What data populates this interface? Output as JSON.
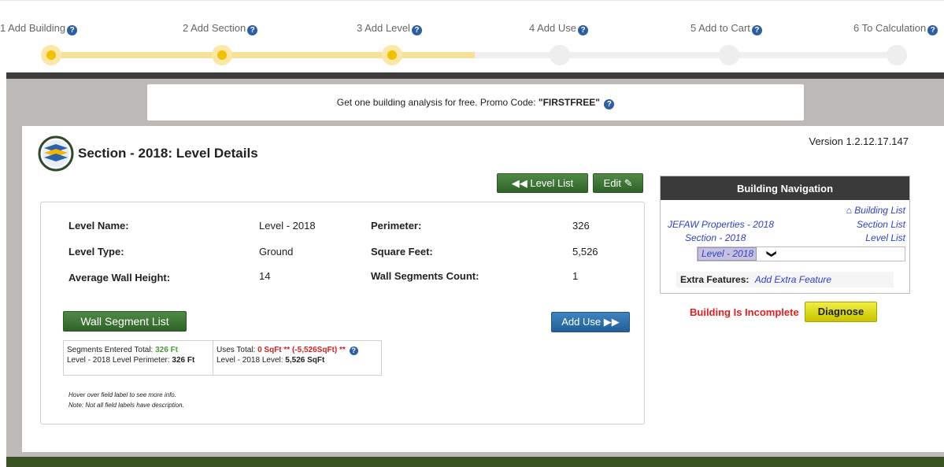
{
  "wizard": {
    "steps": [
      {
        "label": "1 Add Building",
        "state": "done"
      },
      {
        "label": "2 Add Section",
        "state": "done"
      },
      {
        "label": "3 Add Level",
        "state": "done"
      },
      {
        "label": "4 Add Use",
        "state": "todo"
      },
      {
        "label": "5 Add to Cart",
        "state": "todo"
      },
      {
        "label": "6 To Calculation",
        "state": "todo"
      }
    ]
  },
  "promo": {
    "text": "Get one building analysis for free. Promo Code: ",
    "code": "\"FIRSTFREE\""
  },
  "header": {
    "title": "Section - 2018: Level Details",
    "version": "Version 1.2.12.17.147"
  },
  "actions": {
    "level_list": "Level List",
    "edit": "Edit",
    "wall_segment_list": "Wall Segment List",
    "add_use": "Add Use"
  },
  "details": {
    "level_name_label": "Level Name:",
    "level_name": "Level - 2018",
    "level_type_label": "Level Type:",
    "level_type": "Ground",
    "avg_wall_height_label": "Average Wall Height:",
    "avg_wall_height": "14",
    "perimeter_label": "Perimeter:",
    "perimeter": "326",
    "square_feet_label": "Square Feet:",
    "square_feet": "5,526",
    "wall_segments_label": "Wall Segments Count:",
    "wall_segments": "1"
  },
  "summary": {
    "segments_label": "Segments Entered Total:",
    "segments_value": "326 Ft",
    "perimeter_label": "Level - 2018 Level Perimeter:",
    "perimeter_value": "326 Ft",
    "uses_label": "Uses Total:",
    "uses_value": "0 SqFt ** (-5,526SqFt) **",
    "level_label": "Level - 2018 Level:",
    "level_value": "5,526 SqFt"
  },
  "notes": {
    "hover": "Hover over field label to see more info.",
    "note": "Note: Not all field labels have description."
  },
  "navigation": {
    "title": "Building Navigation",
    "building_list": "Building List",
    "section_list": "Section List",
    "level_list": "Level List",
    "property": "JEFAW Properties - 2018",
    "section": "Section - 2018",
    "level": "Level - 2018",
    "extra_label": "Extra Features:",
    "extra_link": "Add Extra Feature"
  },
  "status": {
    "incomplete": "Building Is Incomplete",
    "diagnose": "Diagnose"
  },
  "colors": {
    "accent_yellow": "#f2c200",
    "green_button": "#3d7535",
    "blue_button": "#2f6fab",
    "error_red": "#e02020",
    "link_blue": "#2f3fd0"
  }
}
